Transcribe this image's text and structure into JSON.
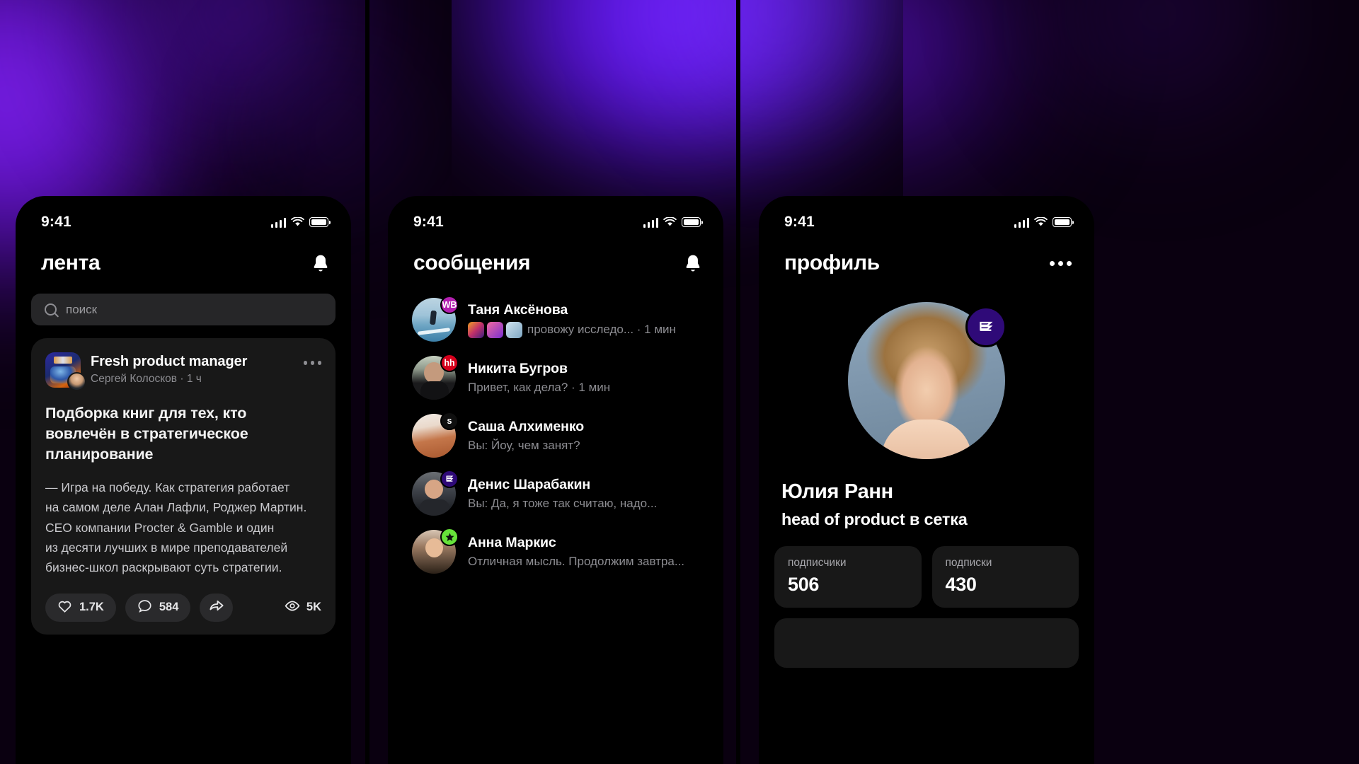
{
  "theme": {
    "accent_purple": "#7b2bff",
    "card_bg": "#181818",
    "screen_bg": "#000000",
    "muted_text": "#8d8d92",
    "badge_wb": "#b31fb0",
    "badge_hh": "#d6001c",
    "badge_s": "#0f0f0f",
    "badge_green": "#67e33a",
    "logo_purple": "#2f0a78"
  },
  "screens": [
    {
      "id": "feed",
      "status": {
        "time": "9:41",
        "signal": "signal-icon",
        "wifi": "wifi-icon",
        "battery": "battery-icon"
      },
      "header": {
        "title": "лента",
        "action_icon": "bell-icon"
      },
      "search": {
        "placeholder": "поиск",
        "value": "",
        "icon": "search-icon"
      },
      "post": {
        "channel": "Fresh product manager",
        "author_line": "Сергей Колосков · 1 ч",
        "more_icon": "more-horizontal-icon",
        "heading": "Подборка книг для тех, кто вовлечён в стратегическое планирование",
        "body": "— Игра на победу. Как стратегия работает\nна самом деле Алан Лафли, Роджер Мартин.\nCEO компании Procter & Gamble и один\nиз десяти лучших в мире преподавателей\nбизнес-школ раскрывают суть стратегии.",
        "actions": {
          "likes": "1.7K",
          "likes_icon": "heart-icon",
          "comments": "584",
          "comments_icon": "comment-icon",
          "share_icon": "share-icon",
          "views": "5K",
          "views_icon": "eye-icon"
        }
      }
    },
    {
      "id": "messages",
      "status": {
        "time": "9:41",
        "signal": "signal-icon",
        "wifi": "wifi-icon",
        "battery": "battery-icon"
      },
      "header": {
        "title": "сообщения",
        "action_icon": "bell-icon"
      },
      "chats": [
        {
          "name": "Таня Аксёнова",
          "preview": "провожу исследо... · 1 мин",
          "badge": "WB",
          "badge_color": "#b31fb0",
          "has_stickers": true
        },
        {
          "name": "Никита Бугров",
          "preview": "Привет, как дела? · 1 мин",
          "badge": "hh",
          "badge_color": "#d6001c",
          "has_stickers": false
        },
        {
          "name": "Саша Алхименко",
          "preview": "Вы: Йоу, чем занят?",
          "badge": "s",
          "badge_color": "#0f0f0f",
          "has_stickers": false
        },
        {
          "name": "Денис Шарабакин",
          "preview": "Вы: Да, я тоже так считаю, надо...",
          "badge": "logo",
          "badge_color": "#2f0a78",
          "has_stickers": false
        },
        {
          "name": "Анна Маркис",
          "preview": "Отличная мысль. Продолжим завтра...",
          "badge": "star",
          "badge_color": "#67e33a",
          "has_stickers": false
        }
      ]
    },
    {
      "id": "profile",
      "status": {
        "time": "9:41",
        "signal": "signal-icon",
        "wifi": "wifi-icon",
        "battery": "battery-icon"
      },
      "header": {
        "title": "профиль",
        "action_icon": "more-horizontal-icon"
      },
      "user": {
        "avatar": "user-photo",
        "logo_badge": "setka-logo-icon",
        "name": "Юлия Ранн",
        "role": "head of product в сетка"
      },
      "stats": [
        {
          "label": "подписчики",
          "value": "506"
        },
        {
          "label": "подписки",
          "value": "430"
        }
      ]
    }
  ]
}
